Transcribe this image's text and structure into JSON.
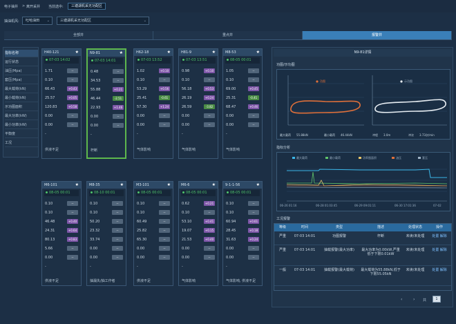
{
  "breadcrumb": {
    "l1": "电子抽井",
    "sep": ">",
    "l2": "离开采井",
    "l3": "当前选中:",
    "current": "三塘湖机采无功配区"
  },
  "filter": {
    "label": "抽油机风:",
    "sel1": "吐哈油田",
    "sel2": "三塘湖机采无功配区"
  },
  "tabs": [
    {
      "label": "全部井"
    },
    {
      "label": "重点井"
    },
    {
      "label": "报警井"
    }
  ],
  "row_labels": [
    "指标名称",
    "运行状态",
    "油压(Mpa)",
    "套压(Mpa)",
    "最大载荷(kN)",
    "最小载荷(kN)",
    "示功图面积",
    "最大功率(kW)",
    "最小功率(kW)",
    "平衡度",
    "工况"
  ],
  "top_wells": [
    {
      "name": "H40-121",
      "time": "07-03 14:02",
      "vals": [
        "1.71",
        "0.10",
        "66.43",
        "25.57",
        "120.83",
        "0.00",
        "0.00",
        "-",
        ""
      ],
      "badges": [
        "--",
        "--",
        "+0.43",
        "+0.05",
        "+0.58",
        "--",
        "--",
        "",
        ""
      ],
      "foot": "供液不足"
    },
    {
      "name": "N9-81",
      "time": "07-03 14:01",
      "vals": [
        "0.48",
        "34.53",
        "55.88",
        "46.44",
        "22.93",
        "0.00",
        "0.00",
        "-",
        ""
      ],
      "badges": [
        "--",
        "--",
        "+0.21",
        "-2.51",
        "+1.46",
        "--",
        "--",
        "",
        ""
      ],
      "foot": "杆断"
    },
    {
      "name": "H62-18",
      "time": "07-03 13:52",
      "vals": [
        "1.02",
        "0.10",
        "53.29",
        "25.41",
        "57.30",
        "0.00",
        "0.00",
        "-",
        ""
      ],
      "badges": [
        "+0.10",
        "--",
        "+0.56",
        "-0.61",
        "+1.24",
        "--",
        "--",
        "",
        ""
      ],
      "foot": "气体影响"
    },
    {
      "name": "H81-9",
      "time": "07-03 13:51",
      "vals": [
        "0.98",
        "0.10",
        "56.18",
        "26.19",
        "26.59",
        "0.00",
        "0.00",
        "-",
        ""
      ],
      "badges": [
        "+0.10",
        "--",
        "+0.53",
        "+0.24",
        "-3.82",
        "--",
        "--",
        "",
        ""
      ],
      "foot": "气体影响"
    },
    {
      "name": "M8-53",
      "time": "08-05 00:01",
      "vals": [
        "1.05",
        "0.10",
        "69.00",
        "25.31",
        "68.47",
        "0.00",
        "0.00",
        "-",
        ""
      ],
      "badges": [
        "--",
        "--",
        "+0.45",
        "-0.41",
        "+0.46",
        "--",
        "--",
        "",
        ""
      ],
      "foot": "气体影响"
    }
  ],
  "bottom_wells": [
    {
      "name": "M6-101",
      "time": "08-05 00:01",
      "vals": [
        "0.10",
        "0.10",
        "46.48",
        "24.31",
        "80.13",
        "5.66",
        "0.00",
        "-"
      ],
      "badges": [
        "--",
        "--",
        "+0.40",
        "+0.64",
        "+0.83",
        "--",
        "--",
        ""
      ],
      "foot": "供液不足"
    },
    {
      "name": "M8-35",
      "time": "08-10 00:01",
      "vals": [
        "0.10",
        "0.10",
        "50.20",
        "23.32",
        "33.74",
        "0.00",
        "0.00",
        "-"
      ],
      "badges": [
        "--",
        "--",
        "--",
        "--",
        "--",
        "--",
        "--",
        ""
      ],
      "foot": "抽漏失/抽工作者"
    },
    {
      "name": "M3-101",
      "time": "08-05 00:01",
      "vals": [
        "0.10",
        "0.10",
        "60.49",
        "25.82",
        "65.30",
        "0.00",
        "0.00",
        "-"
      ],
      "badges": [
        "--",
        "--",
        "--",
        "--",
        "--",
        "--",
        "--",
        ""
      ],
      "foot": "供液不足"
    },
    {
      "name": "M6-6",
      "time": "08-05 00:01",
      "vals": [
        "0.62",
        "0.10",
        "53.10",
        "19.07",
        "21.53",
        "0.00",
        "0.00",
        "-"
      ],
      "badges": [
        "+0.21",
        "--",
        "+0.41",
        "+0.15",
        "+0.40",
        "--",
        "--",
        ""
      ],
      "foot": "气体影响"
    },
    {
      "name": "9-1-1-56",
      "time": "08-05 00:01",
      "vals": [
        "0.10",
        "0.10",
        "60.94",
        "28.45",
        "31.63",
        "0.00",
        "0.00",
        "-"
      ],
      "badges": [
        "--",
        "--",
        "+0.61",
        "+0.18",
        "+0.24",
        "--",
        "--",
        ""
      ],
      "foot": "气体影响, 供液不足"
    }
  ],
  "right": {
    "title": "N9-81详情",
    "sec1": "功图/示功图",
    "sec2": "指标分析",
    "sec3": "工况报警",
    "stats1": [
      "最大载荷",
      "55.88kN",
      "最小载荷",
      "46.44kN"
    ],
    "stats2": [
      "冲程",
      "3.0m",
      "冲次",
      "3.73次/min"
    ],
    "chart1_legend": "功图",
    "chart2_legend": "示功图",
    "chart3_legend": [
      "最大载荷",
      "最小载荷",
      "功率图面积",
      "油压",
      "套压"
    ],
    "chart3_xlabels": [
      "06-26 01:16",
      "06-28 01:03:45",
      "06-29 09:01:11",
      "06-30 17:01:36",
      "07-02"
    ]
  },
  "alarm_table": {
    "headers": [
      "等级",
      "时间",
      "类型",
      "描述",
      "处理状态",
      "操作"
    ],
    "rows": [
      {
        "level": "严重",
        "time": "07-03 14:01",
        "type": "功图报警",
        "desc": "杆断",
        "status": "未读/未处理",
        "ops": "处置 解除"
      },
      {
        "level": "严重",
        "time": "07-03 14:01",
        "type": "抽载报警(最大功率)",
        "desc": "最大功率为0.00kW,严重低于下限0.01kW",
        "status": "未读/未处理",
        "ops": "处置 解除"
      },
      {
        "level": "一般",
        "time": "07-03 14:01",
        "type": "抽载报警(最大载荷)",
        "desc": "最大载荷为55.88kN,低于下限55.05kN",
        "status": "未读/未处理",
        "ops": "处置 解除"
      }
    ]
  },
  "pager": {
    "prev": "‹",
    "next": "›",
    "page": "1",
    "total": "共"
  },
  "colors": {
    "green": "#4fc66b",
    "purple": "#7e56a8",
    "blue": "#3a7fb8",
    "orange": "#e0703a"
  }
}
